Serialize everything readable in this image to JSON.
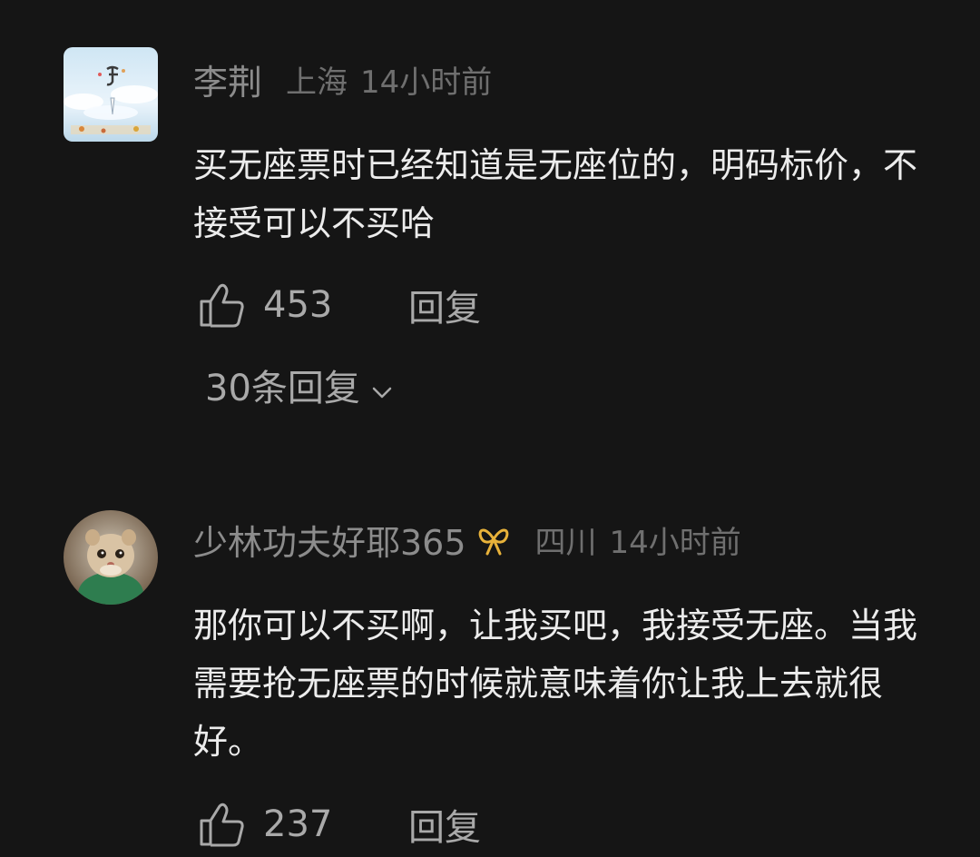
{
  "comments": [
    {
      "username": "李荆",
      "location": "上海",
      "time": "14小时前",
      "text": "买无座票时已经知道是无座位的，明码标价，不接受可以不买哈",
      "likes": "453",
      "reply_label": "回复",
      "replies_label": "30条回复",
      "avatar": "illustrated-sky-avatar"
    },
    {
      "username": "少林功夫好耶365",
      "badge": "gold-ribbon-badge-icon",
      "location": "四川",
      "time": "14小时前",
      "text": "那你可以不买啊，让我买吧，我接受无座。当我需要抢无座票的时候就意味着你让我上去就很好。",
      "likes": "237",
      "reply_label": "回复",
      "avatar": "hamster-photo-avatar"
    }
  ],
  "colors": {
    "background": "#151515",
    "username": "#8c8c8c",
    "meta": "#6f6f6f",
    "body_text": "#ececec",
    "action_text": "#a9a9a9",
    "badge": "#e8b23a"
  }
}
